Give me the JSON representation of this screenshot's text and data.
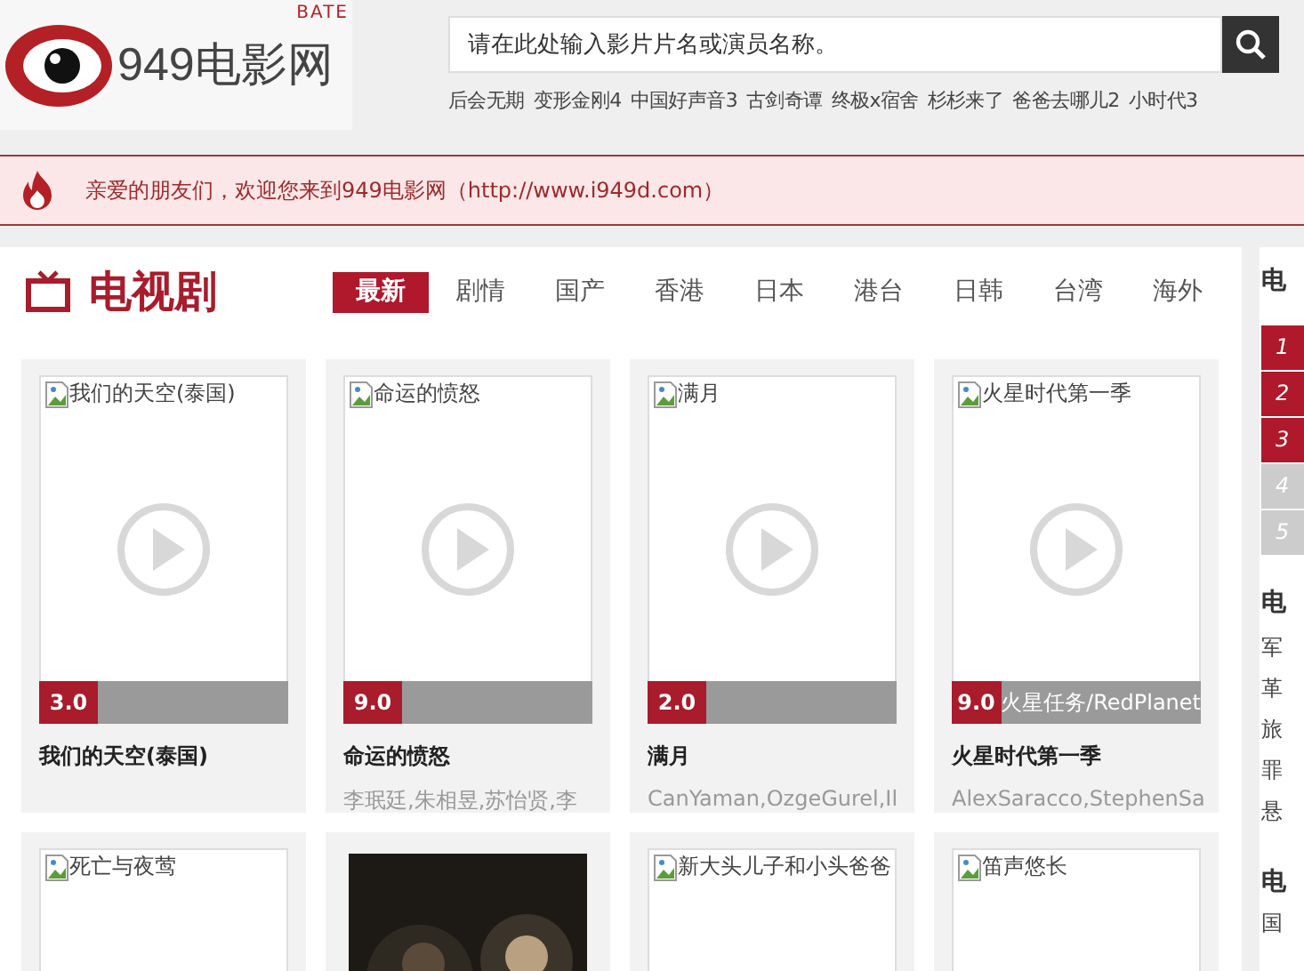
{
  "logo": {
    "text": "949电影网",
    "badge": "BATE"
  },
  "search": {
    "placeholder": "请在此处输入影片片名或演员名称。"
  },
  "hot_links": [
    "后会无期",
    "变形金刚4",
    "中国好声音3",
    "古剑奇谭",
    "终极x宿舍",
    "杉杉来了",
    "爸爸去哪儿2",
    "小时代3"
  ],
  "notice": {
    "text": "亲爱的朋友们，欢迎您来到949电影网（http://www.i949d.com）"
  },
  "section": {
    "title": "电视剧",
    "tabs": [
      {
        "label": "最新",
        "selected": true
      },
      {
        "label": "剧情",
        "selected": false
      },
      {
        "label": "国产",
        "selected": false
      },
      {
        "label": "香港",
        "selected": false
      },
      {
        "label": "日本",
        "selected": false
      },
      {
        "label": "港台",
        "selected": false
      },
      {
        "label": "日韩",
        "selected": false
      },
      {
        "label": "台湾",
        "selected": false
      },
      {
        "label": "海外",
        "selected": false
      }
    ]
  },
  "cards": [
    {
      "kind": "broken",
      "image_alt": "我们的天空(泰国)",
      "score": "3.0",
      "title": "我们的天空(泰国)"
    },
    {
      "kind": "broken",
      "image_alt": "命运的愤怒",
      "score": "9.0",
      "title": "命运的愤怒",
      "actors": "李珉廷,朱相昱,苏怡贤,李"
    },
    {
      "kind": "broken",
      "image_alt": "满月",
      "score": "2.0",
      "title": "满月",
      "actors": "CanYaman,OzgeGurel,Il"
    },
    {
      "kind": "broken",
      "image_alt": "火星时代第一季",
      "score": "9.0",
      "caption": "火星任务/RedPlanet",
      "title": "火星时代第一季",
      "actors": "AlexSaracco,StephenSa"
    },
    {
      "kind": "broken",
      "image_alt": "死亡与夜莺"
    },
    {
      "kind": "picture"
    },
    {
      "kind": "broken",
      "image_alt": "新大头儿子和小头爸爸"
    },
    {
      "kind": "broken",
      "image_alt": "笛声悠长"
    }
  ],
  "sidebar": {
    "heading": "电",
    "ranks": [
      {
        "number": "1",
        "top": true
      },
      {
        "number": "2",
        "top": true
      },
      {
        "number": "3",
        "top": true
      },
      {
        "number": "4",
        "top": false
      },
      {
        "number": "5",
        "top": false
      }
    ],
    "heading_2": "电",
    "genres": [
      "军",
      "革",
      "旅",
      "罪",
      "悬"
    ],
    "heading_3": "电",
    "genres_3": [
      "国"
    ]
  }
}
